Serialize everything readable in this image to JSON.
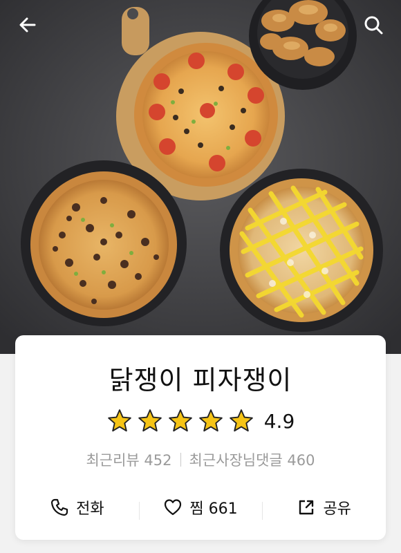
{
  "header": {
    "back_icon": "back-arrow-icon",
    "search_icon": "search-icon"
  },
  "store": {
    "name": "닭쟁이 피자쟁이",
    "rating": "4.9",
    "rating_value": 4.9,
    "stars_max": 5,
    "star_color": "#f6c416"
  },
  "reviews": {
    "recent_reviews": "최근리뷰 452",
    "owner_replies": "최근사장님댓글 460"
  },
  "actions": {
    "call_label": "전화",
    "like_label": "찜 661",
    "share_label": "공유"
  },
  "colors": {
    "background": "#f2f2f2",
    "card": "#ffffff",
    "muted_text": "#9a9a9a"
  }
}
